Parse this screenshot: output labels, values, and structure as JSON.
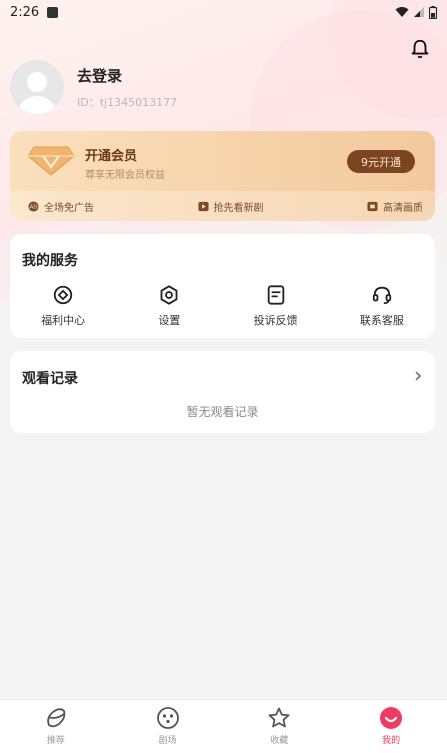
{
  "status_bar": {
    "time": "2:26"
  },
  "profile": {
    "login_text": "去登录",
    "user_id": "ID：tj1345013177"
  },
  "vip": {
    "title": "开通会员",
    "subtitle": "尊享无限会员权益",
    "button": "9元开通",
    "perks": [
      {
        "icon": "no-ads-icon",
        "label": "全场免广告"
      },
      {
        "icon": "play-box-icon",
        "label": "抢先看新剧"
      },
      {
        "icon": "hd-box-icon",
        "label": "高清画质"
      }
    ]
  },
  "services": {
    "title": "我的服务",
    "items": [
      {
        "icon": "welfare-icon",
        "label": "福利中心"
      },
      {
        "icon": "settings-icon",
        "label": "设置"
      },
      {
        "icon": "feedback-icon",
        "label": "投诉反馈"
      },
      {
        "icon": "headset-icon",
        "label": "联系客服"
      }
    ]
  },
  "history": {
    "title": "观看记录",
    "empty_text": "暂无观看记录"
  },
  "tabbar": {
    "items": [
      {
        "icon": "recommend-icon",
        "label": "推荐",
        "active": false
      },
      {
        "icon": "theater-icon",
        "label": "剧场",
        "active": false
      },
      {
        "icon": "star-icon",
        "label": "收藏",
        "active": false
      },
      {
        "icon": "mine-icon",
        "label": "我的",
        "active": true
      }
    ]
  },
  "colors": {
    "accent": "#ee3c61",
    "vip_button": "#7a4520",
    "vip_text": "#6b3a16"
  }
}
